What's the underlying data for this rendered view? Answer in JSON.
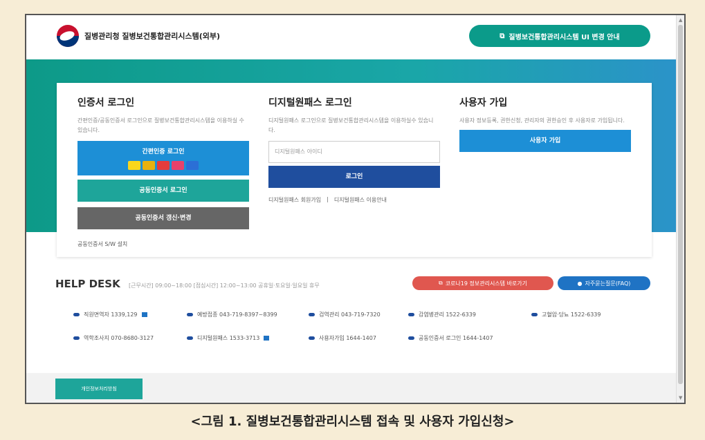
{
  "header": {
    "site_title": "질병관리청 질병보건통합관리시스템(외부)",
    "notice_button": "질병보건통합관리시스템 UI 변경 안내",
    "notice_icon": "external-link-icon"
  },
  "cert_login": {
    "title": "인증서 로그인",
    "desc": "간편인증/공동인증서 로그인으로 질병보건통합관리시스템을 이용하실 수 있습니다.",
    "simple_button": "간편인증 로그인",
    "cert_providers": [
      {
        "name": "kakao-icon",
        "color": "#f9d71c"
      },
      {
        "name": "pass-icon",
        "color": "#e8b10e"
      },
      {
        "name": "toss-icon",
        "color": "#e63c3c"
      },
      {
        "name": "payco-icon",
        "color": "#e8416b"
      },
      {
        "name": "naver-icon",
        "color": "#2b6fd6"
      }
    ],
    "joint_button": "공동인증서 로그인",
    "renew_button": "공동인증서 갱신·변경",
    "sw_link": "공동인증서 S/W 설치"
  },
  "digital_login": {
    "title": "디지털원패스 로그인",
    "desc": "디지털원패스 로그인으로 질병보건통합관리시스템을 이용하실수 있습니다.",
    "id_placeholder": "디지털원패스 아이디",
    "login_button": "로그인",
    "link_join": "디지털원패스 회원가입",
    "link_guide": "디지털원패스 이용안내"
  },
  "signup": {
    "title": "사용자 가입",
    "desc": "사용자 정보등록, 권한신청, 관리자의 권한승인 후 사용자로 가입됩니다.",
    "button": "사용자 가입"
  },
  "help": {
    "title": "HELP DESK",
    "hours": "[근무시간] 09:00~18:00 [점심시간] 12:00~13:00 공휴일·토요일·일요일 휴무",
    "pill_red": "코로나19 정보관리시스템 바로가기",
    "pill_blue": "자주묻는질문(FAQ)",
    "row1": [
      "직원면역자 1339,129",
      "예방접종 043-719-8397~8399",
      "검역관리 043-719-7320",
      "감염병관리 1522-6339",
      "고혈압·당뇨 1522-6339"
    ],
    "row2": [
      "역학조사지 070-8680-3127",
      "디지털원패스 1533-3713",
      "사용자가입 1644-1407",
      "공동인증서 로그인 1644-1407"
    ]
  },
  "footer": {
    "privacy": "개인정보처리방침"
  },
  "caption": "<그림 1. 질병보건통합관리시스템 접속 및 사용자 가입신청>"
}
